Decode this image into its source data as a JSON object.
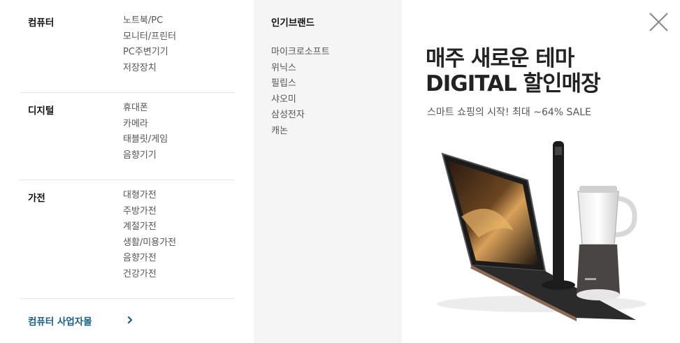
{
  "categories": [
    {
      "title": "컴퓨터",
      "items": [
        "노트북/PC",
        "모니터/프린터",
        "PC주변기기",
        "저장장치"
      ]
    },
    {
      "title": "디지털",
      "items": [
        "휴대폰",
        "카메라",
        "태블릿/게임",
        "음향기기"
      ]
    },
    {
      "title": "가전",
      "items": [
        "대형가전",
        "주방가전",
        "계절가전",
        "생활/미용가전",
        "음향가전",
        "건강가전"
      ]
    }
  ],
  "business_link": {
    "label": "컴퓨터 사업자몰",
    "icon": "chevron-right-icon"
  },
  "brands": {
    "title": "인기브랜드",
    "items": [
      "마이크로소프트",
      "위닉스",
      "필립스",
      "샤오미",
      "삼성전자",
      "캐논"
    ]
  },
  "banner": {
    "line1": "매주 새로운 테마",
    "line2": "DIGITAL 할인매장",
    "subtitle": "스마트 쇼핑의 시작! 최대 ~64% SALE"
  },
  "close_icon": "close-icon",
  "colors": {
    "link": "#1a5e86",
    "brand_bg": "#f5f5f5",
    "divider": "#e6e6e6"
  }
}
